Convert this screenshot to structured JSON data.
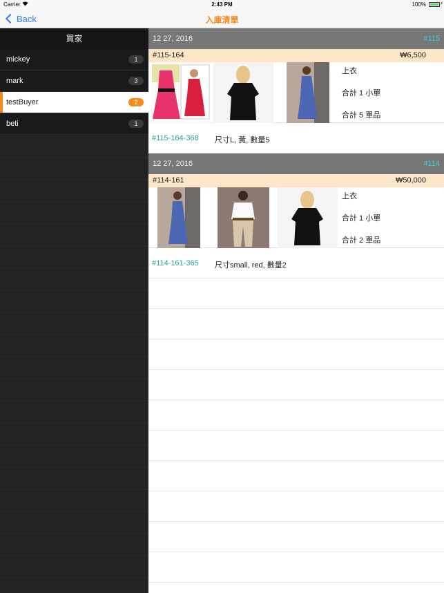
{
  "status_bar": {
    "carrier": "Carrier",
    "time": "2:43 PM",
    "battery": "100%"
  },
  "nav": {
    "back_label": "Back",
    "title": "入庫清單",
    "title_color": "#f58a1f"
  },
  "sidebar": {
    "header": "買家",
    "items": [
      {
        "name": "mickey",
        "count": "1"
      },
      {
        "name": "mark",
        "count": "3"
      },
      {
        "name": "testBuyer",
        "count": "2",
        "selected": true
      },
      {
        "name": "beti",
        "count": "1"
      }
    ]
  },
  "sections": [
    {
      "date": "12 27, 2016",
      "number": "#115",
      "order_id": "#115-164",
      "amount": "₩6,500",
      "category": "上衣",
      "total_orders": "合計 1 小單",
      "total_items": "合計 5 單品",
      "thumbnails": [
        "pink-dress-with-belt",
        "black-dress-choker",
        "blue-wrap-dress"
      ],
      "detail_code": "#115-164-368",
      "detail_spec": "尺寸L, 黃, 數量5"
    },
    {
      "date": "12 27, 2016",
      "number": "#114",
      "order_id": "#114-161",
      "amount": "₩50,000",
      "category": "上衣",
      "total_orders": "合計 1 小單",
      "total_items": "合計 2 單品",
      "thumbnails": [
        "blue-wrap-dress",
        "white-blouse-khaki-pants",
        "black-dress-choker"
      ],
      "detail_code": "#114-161-365",
      "detail_spec": "尺寸small, red, 數量2"
    }
  ]
}
